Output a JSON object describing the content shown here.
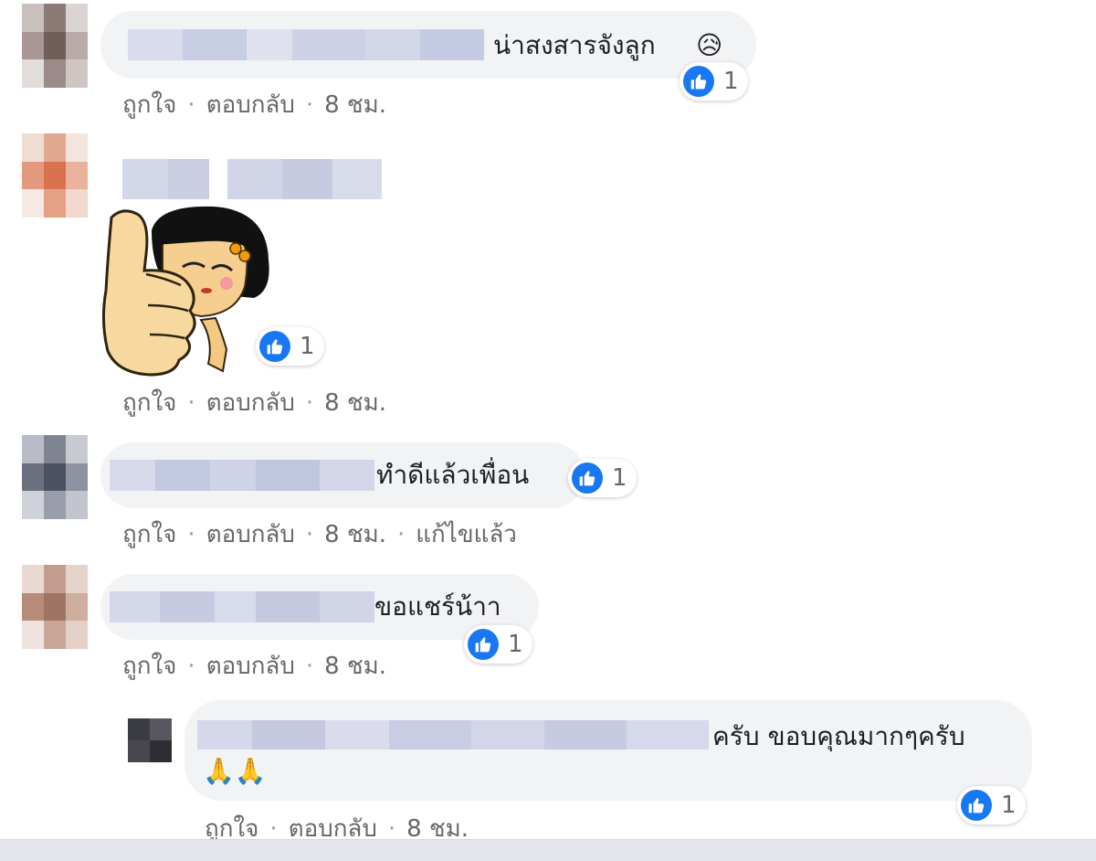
{
  "colors": {
    "accent": "#1877f2",
    "bubble": "#f2f3f5",
    "meta": "#65676b"
  },
  "comments": [
    {
      "text": "น่าสงสารจังลูก",
      "emoji": "😥",
      "reactions": {
        "icon": "like-icon",
        "count": "1"
      },
      "actions": {
        "like": "ถูกใจ",
        "reply": "ตอบกลับ",
        "time": "8 ชม."
      }
    },
    {
      "sticker": "thumbs-up-girl-sticker",
      "reactions": {
        "icon": "like-icon",
        "count": "1"
      },
      "actions": {
        "like": "ถูกใจ",
        "reply": "ตอบกลับ",
        "time": "8 ชม."
      }
    },
    {
      "text": "ทำดีแล้วเพื่อน",
      "reactions": {
        "icon": "like-icon",
        "count": "1"
      },
      "actions": {
        "like": "ถูกใจ",
        "reply": "ตอบกลับ",
        "time": "8 ชม.",
        "edited": "แก้ไขแล้ว"
      }
    },
    {
      "text": "ขอแชร์น้าา",
      "reactions": {
        "icon": "like-icon",
        "count": "1"
      },
      "actions": {
        "like": "ถูกใจ",
        "reply": "ตอบกลับ",
        "time": "8 ชม."
      }
    }
  ],
  "reply": {
    "text": "ครับ ขอบคุณมากๆครับ",
    "emoji": "🙏🙏",
    "reactions": {
      "icon": "like-icon",
      "count": "1"
    },
    "actions": {
      "like": "ถูกใจ",
      "reply": "ตอบกลับ",
      "time": "8 ชม."
    }
  }
}
